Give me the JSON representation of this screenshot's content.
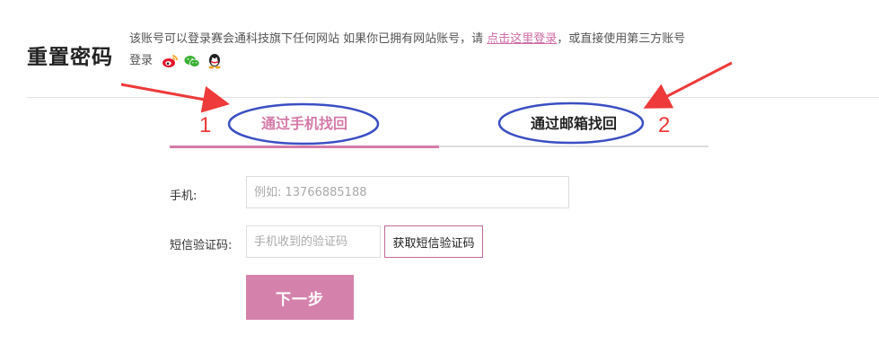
{
  "page": {
    "title": "重置密码",
    "intro_text": "该账号可以登录赛会通科技旗下任何网站 如果你已拥有网站账号，请",
    "login_link": "点击这里登录",
    "intro_suffix": "，或直接使用第三方账号登录"
  },
  "social": [
    {
      "name": "weibo-icon",
      "color": "#e6162d"
    },
    {
      "name": "wechat-icon",
      "color": "#3bb034"
    },
    {
      "name": "qq-icon",
      "color": "#222222"
    }
  ],
  "tabs": [
    {
      "label": "通过手机找回",
      "active": true
    },
    {
      "label": "通过邮箱找回",
      "active": false
    }
  ],
  "form": {
    "phone_label": "手机:",
    "phone_placeholder": "例如: 13766885188",
    "code_label": "短信验证码:",
    "code_placeholder": "手机收到的验证码",
    "sms_button": "获取短信验证码",
    "next_button": "下一步"
  },
  "annotations": {
    "number_1": "1",
    "number_2": "2",
    "color": "#ee3a3a",
    "circle_color": "#3b4fc4"
  },
  "colors": {
    "accent": "#d57aa8",
    "button_bg": "#d482ac"
  }
}
